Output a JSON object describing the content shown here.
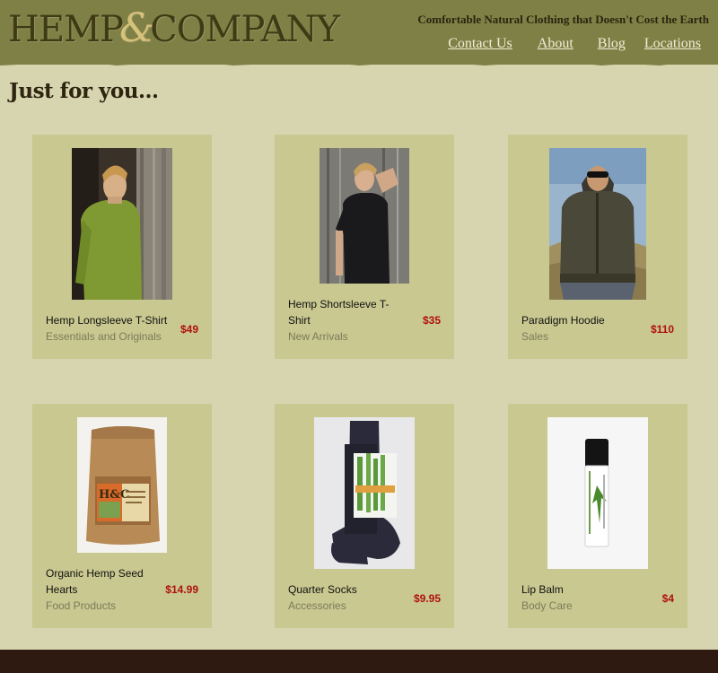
{
  "brand": {
    "name_part1": "HEMP",
    "ampersand": "&",
    "name_part2": "COMPANY",
    "tagline": "Comfortable Natural Clothing that Doesn't Cost the Earth"
  },
  "nav": [
    "Contact Us",
    "About",
    "Blog",
    "Locations"
  ],
  "page_title": "Just for you...",
  "products": [
    {
      "name": "Hemp Longsleeve T-Shirt",
      "category": "Essentials and Originals",
      "price": "$49",
      "image": "man-green-longsleeve-photo"
    },
    {
      "name": "Hemp Shortsleeve T-Shirt",
      "category": "New Arrivals",
      "price": "$35",
      "image": "man-black-tshirt-photo"
    },
    {
      "name": "Paradigm Hoodie",
      "category": "Sales",
      "price": "$110",
      "image": "man-hoodie-sunglasses-photo"
    },
    {
      "name": "Organic Hemp Seed Hearts",
      "category": "Food Products",
      "price": "$14.99",
      "image": "hemp-seed-pouch-photo"
    },
    {
      "name": "Quarter Socks",
      "category": "Accessories",
      "price": "$9.95",
      "image": "navy-socks-photo"
    },
    {
      "name": "Lip Balm",
      "category": "Body Care",
      "price": "$4",
      "image": "lip-balm-tube-photo"
    }
  ],
  "colors": {
    "header": "#7f8045",
    "background": "#d7d5b0",
    "card": "#c9c890",
    "price": "#b01010",
    "footer": "#2e1a10"
  }
}
